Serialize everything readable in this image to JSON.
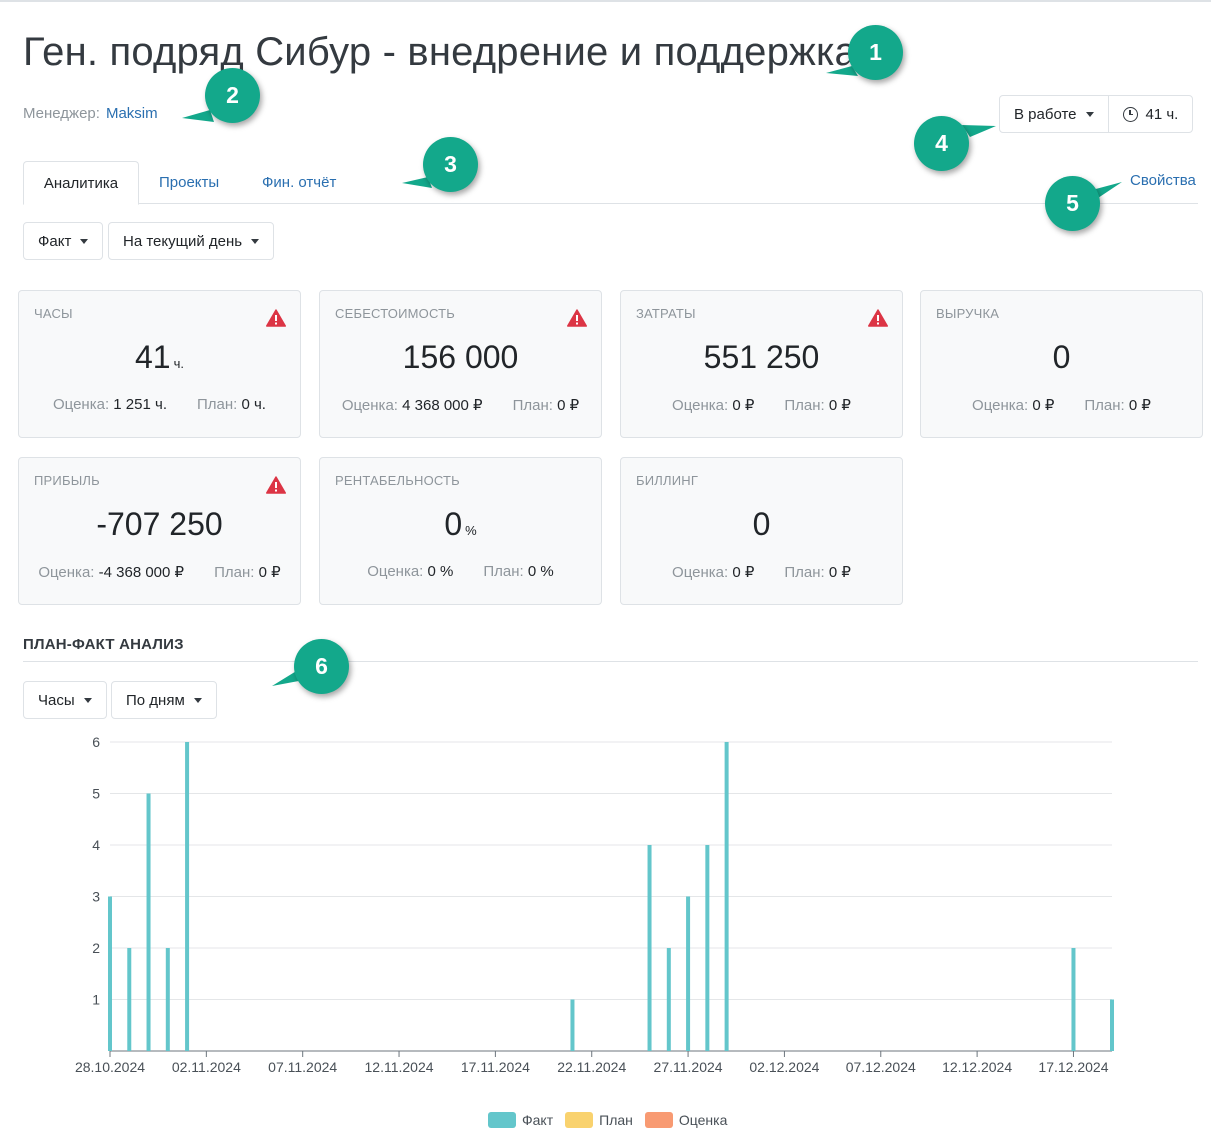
{
  "header": {
    "title": "Ген. подряд Сибур - внедрение и поддержка",
    "manager_label": "Менеджер:",
    "manager_name": "Maksim",
    "status": "В работе",
    "hours": "41 ч."
  },
  "tabs": [
    {
      "label": "Аналитика",
      "active": true
    },
    {
      "label": "Проекты",
      "active": false
    },
    {
      "label": "Фин. отчёт",
      "active": false
    }
  ],
  "properties_link": "Свойства",
  "filters": {
    "mode": "Факт",
    "period": "На текущий день"
  },
  "metrics": [
    {
      "label": "ЧАСЫ",
      "value": "41",
      "unit": "ч.",
      "warning": true,
      "estimate_label": "Оценка:",
      "estimate": "1 251 ч.",
      "plan_label": "План:",
      "plan": "0 ч."
    },
    {
      "label": "СЕБЕСТОИМОСТЬ",
      "value": "156 000",
      "unit": "",
      "warning": true,
      "estimate_label": "Оценка:",
      "estimate": "4 368 000 ₽",
      "plan_label": "План:",
      "plan": "0 ₽"
    },
    {
      "label": "ЗАТРАТЫ",
      "value": "551 250",
      "unit": "",
      "warning": true,
      "estimate_label": "Оценка:",
      "estimate": "0 ₽",
      "plan_label": "План:",
      "plan": "0 ₽"
    },
    {
      "label": "ВЫРУЧКА",
      "value": "0",
      "unit": "",
      "warning": false,
      "estimate_label": "Оценка:",
      "estimate": "0 ₽",
      "plan_label": "План:",
      "plan": "0 ₽"
    },
    {
      "label": "ПРИБЫЛЬ",
      "value": "-707 250",
      "unit": "",
      "warning": true,
      "estimate_label": "Оценка:",
      "estimate": "-4 368 000 ₽",
      "plan_label": "План:",
      "plan": "0 ₽"
    },
    {
      "label": "РЕНТАБЕЛЬНОСТЬ",
      "value": "0",
      "unit": "%",
      "warning": false,
      "estimate_label": "Оценка:",
      "estimate": "0 %",
      "plan_label": "План:",
      "plan": "0 %"
    },
    {
      "label": "БИЛЛИНГ",
      "value": "0",
      "unit": "",
      "warning": false,
      "estimate_label": "Оценка:",
      "estimate": "0 ₽",
      "plan_label": "План:",
      "plan": "0 ₽"
    }
  ],
  "analysis": {
    "title": "ПЛАН-ФАКТ АНАЛИЗ",
    "metric_select": "Часы",
    "group_select": "По дням"
  },
  "chart_data": {
    "type": "bar",
    "x_start": "2024-10-28",
    "x_end": "2024-12-19",
    "x_tick_labels": [
      "28.10.2024",
      "02.11.2024",
      "07.11.2024",
      "12.11.2024",
      "17.11.2024",
      "22.11.2024",
      "27.11.2024",
      "02.12.2024",
      "07.12.2024",
      "12.12.2024",
      "17.12.2024"
    ],
    "y_ticks": [
      1,
      2,
      3,
      4,
      5,
      6
    ],
    "ylim": [
      0,
      6
    ],
    "grid": true,
    "legend_position": "bottom",
    "series": [
      {
        "name": "Факт",
        "color": "#63c6cb",
        "points": [
          [
            "2024-10-28",
            3
          ],
          [
            "2024-10-29",
            2
          ],
          [
            "2024-10-30",
            5
          ],
          [
            "2024-10-31",
            2
          ],
          [
            "2024-11-01",
            6
          ],
          [
            "2024-11-21",
            1
          ],
          [
            "2024-11-25",
            4
          ],
          [
            "2024-11-26",
            2
          ],
          [
            "2024-11-27",
            3
          ],
          [
            "2024-11-28",
            4
          ],
          [
            "2024-11-29",
            6
          ],
          [
            "2024-12-17",
            2
          ],
          [
            "2024-12-19",
            1
          ]
        ]
      },
      {
        "name": "План",
        "color": "#f9d26e",
        "points": []
      },
      {
        "name": "Оценка",
        "color": "#f89a72",
        "points": []
      }
    ]
  },
  "annotations": [
    "1",
    "2",
    "3",
    "4",
    "5",
    "6"
  ]
}
